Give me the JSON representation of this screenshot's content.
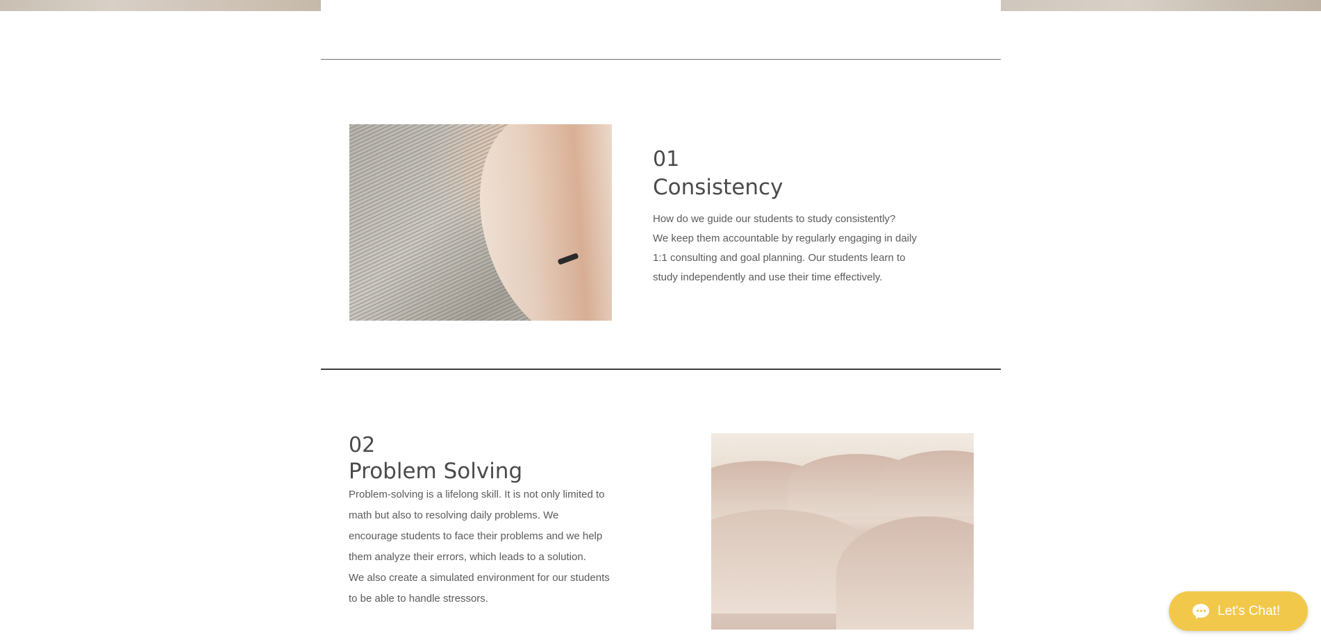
{
  "sections": [
    {
      "number": "01",
      "title": "Consistency",
      "body": [
        "How do we guide our students to study consistently?",
        "We keep them accountable by regularly engaging in daily",
        "1:1 consulting and goal planning. Our students learn to",
        "study independently and use their time effectively."
      ]
    },
    {
      "number": "02",
      "title": "Problem Solving",
      "body": [
        "Problem-solving is a lifelong skill. It is not only limited to",
        "math but also to resolving daily problems. We",
        "encourage students to face their problems and we help",
        "them analyze their errors, which leads to a solution.",
        "We also create a simulated environment for our students",
        "to be able to handle stressors."
      ]
    }
  ],
  "chat": {
    "label": "Let's Chat!"
  },
  "colors": {
    "chat_button": "#f2c84b",
    "text": "#4a4a4a",
    "divider": "#6f6f6f"
  }
}
